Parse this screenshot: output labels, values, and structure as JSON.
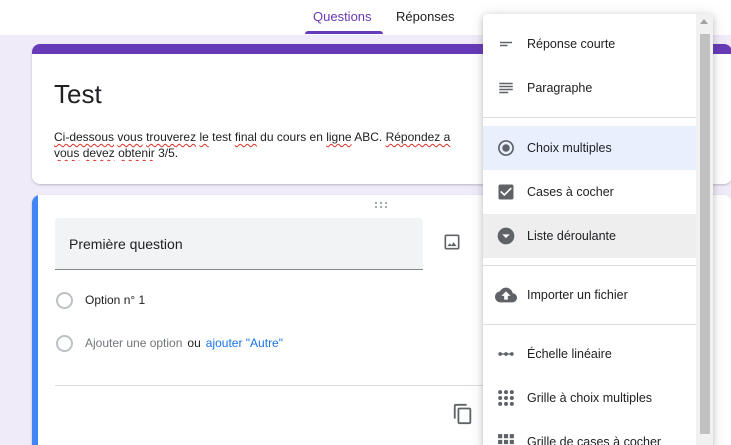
{
  "tabs": [
    {
      "label": "Questions",
      "active": true
    },
    {
      "label": "Réponses",
      "active": false
    }
  ],
  "form": {
    "title": "Test",
    "description": {
      "line1": [
        {
          "text": "Ci-dessous",
          "spell": true
        },
        {
          "text": " ",
          "spell": false
        },
        {
          "text": "vous",
          "spell": true
        },
        {
          "text": " ",
          "spell": false
        },
        {
          "text": "trouverez",
          "spell": true
        },
        {
          "text": " ",
          "spell": false
        },
        {
          "text": "le",
          "spell": true
        },
        {
          "text": " test ",
          "spell": false
        },
        {
          "text": "final",
          "spell": true
        },
        {
          "text": " du cours en ",
          "spell": false
        },
        {
          "text": "ligne",
          "spell": true
        },
        {
          "text": " ABC. ",
          "spell": false
        },
        {
          "text": "Répondez a",
          "spell": true
        }
      ],
      "line2": [
        {
          "text": "vous",
          "spell": true
        },
        {
          "text": " ",
          "spell": false
        },
        {
          "text": "devez",
          "spell": true
        },
        {
          "text": " ",
          "spell": false
        },
        {
          "text": "obtenir",
          "spell": true
        },
        {
          "text": " 3/5.",
          "spell": false
        }
      ]
    }
  },
  "question": {
    "title": "Première question",
    "option1": "Option n° 1",
    "add_option": "Ajouter une option",
    "or_label": "ou",
    "add_other": "ajouter \"Autre\""
  },
  "menu": {
    "items": [
      {
        "label": "Réponse courte",
        "icon": "short-answer-icon"
      },
      {
        "label": "Paragraphe",
        "icon": "paragraph-icon"
      },
      {
        "label": "Choix multiples",
        "icon": "radio-button-icon"
      },
      {
        "label": "Cases à cocher",
        "icon": "checkbox-icon"
      },
      {
        "label": "Liste déroulante",
        "icon": "dropdown-icon"
      },
      {
        "label": "Importer un fichier",
        "icon": "cloud-upload-icon"
      },
      {
        "label": "Échelle linéaire",
        "icon": "linear-scale-icon"
      },
      {
        "label": "Grille à choix multiples",
        "icon": "grid-icon"
      },
      {
        "label": "Grille de cases à cocher",
        "icon": "checkbox-grid-icon"
      }
    ]
  },
  "colors": {
    "accent": "#673ab7",
    "focus": "#4285f4",
    "link": "#1a73e8",
    "background": "#f0ebf8"
  }
}
